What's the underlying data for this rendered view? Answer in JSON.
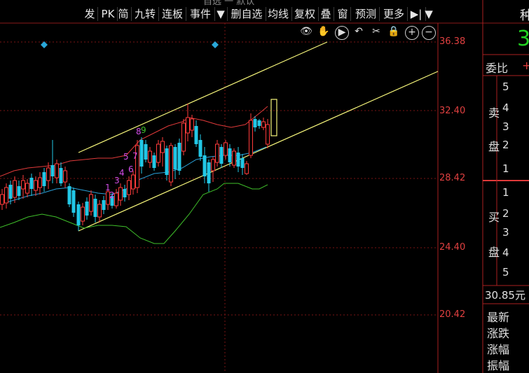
{
  "toolbar": {
    "items": [
      "发",
      "PK",
      "简",
      "九转",
      "连板",
      "事件",
      "▼",
      "删自选",
      "均线",
      "复权",
      "叠",
      "窗",
      "预测",
      "更多",
      "▶|",
      "▼"
    ]
  },
  "top_partial_text": "自选 一 默认",
  "chart_controls": [
    "eye-icon",
    "hand-icon",
    "play-icon",
    "undo-icon",
    "scissors-icon",
    "lock-icon",
    "zoom-in-icon",
    "zoom-out-icon"
  ],
  "price_axis": {
    "labels": [
      "36.38",
      "32.40",
      "28.42",
      "24.40",
      "20.42"
    ]
  },
  "annotations": {
    "purple_counts": [
      "1",
      "2",
      "3",
      "4",
      "5",
      "6",
      "7",
      "8"
    ],
    "green_count": "9"
  },
  "side_panel": {
    "header_partial": "种",
    "big_green_partial": "3",
    "weibi_label": "委比",
    "weibi_sign": "+",
    "sell_label_1": "卖",
    "sell_label_2": "盘",
    "buy_label_1": "买",
    "buy_label_2": "盘",
    "sell_levels": [
      "5",
      "4",
      "3",
      "2",
      "1"
    ],
    "buy_levels": [
      "1",
      "2",
      "3",
      "4",
      "5"
    ],
    "price_unit_partial": "30.85元",
    "stats": [
      "最新",
      "涨跌",
      "涨幅",
      "振幅"
    ]
  },
  "colors": {
    "up": "#ff3b3b",
    "down": "#22c7e6",
    "channel": "#f5f57a",
    "bb_upper": "#e03a3a",
    "bb_mid": "#2aa0d8",
    "bb_lower": "#3fbf2a",
    "axis": "#aa1f1f",
    "diamond": "#2aa7d8",
    "purple": "#d14ce6"
  }
}
